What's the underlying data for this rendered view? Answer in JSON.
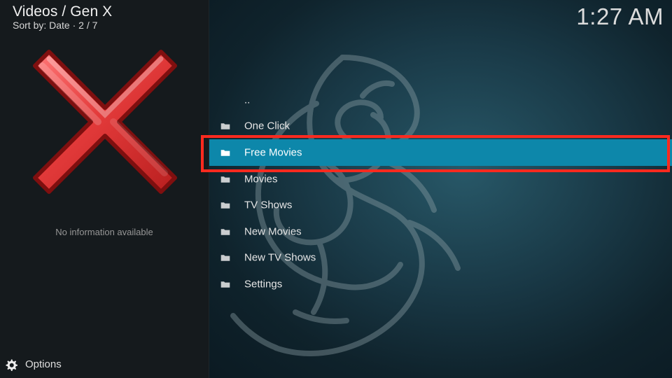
{
  "header": {
    "title": "Videos / Gen X",
    "subtitle": "Sort by: Date  ·  2 / 7",
    "clock": "1:27 AM"
  },
  "left_panel": {
    "no_info_text": "No information available",
    "placeholder_icon": "red-x-icon",
    "options_label": "Options",
    "options_icon": "gear-icon"
  },
  "menu": {
    "items": [
      {
        "label": "..",
        "icon": "none"
      },
      {
        "label": "One Click",
        "icon": "folder-icon"
      },
      {
        "label": "Free Movies",
        "icon": "folder-icon",
        "selected": true
      },
      {
        "label": "Movies",
        "icon": "folder-icon"
      },
      {
        "label": "TV Shows",
        "icon": "folder-icon"
      },
      {
        "label": "New Movies",
        "icon": "folder-icon"
      },
      {
        "label": "New TV Shows",
        "icon": "folder-icon"
      },
      {
        "label": "Settings",
        "icon": "folder-icon"
      }
    ]
  },
  "colors": {
    "selection": "#0d87aa",
    "highlight": "#ff2a1f",
    "left_panel_bg": "#151a1d",
    "right_panel_bg": "#143643",
    "x_red": "#df2f2f"
  }
}
